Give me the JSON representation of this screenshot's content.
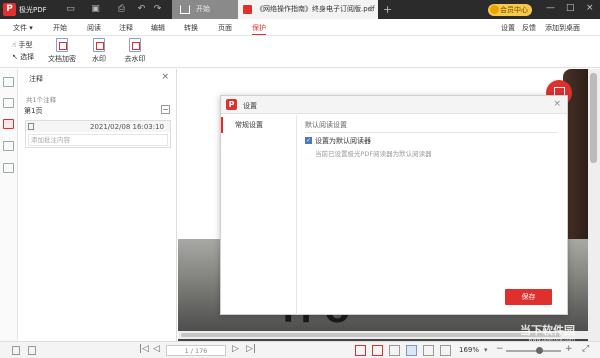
{
  "app": {
    "name": "极光PDF"
  },
  "tabs": [
    {
      "label": "开始"
    },
    {
      "label": "《网络操作指南》终身电子订阅版.pdf"
    }
  ],
  "vip": {
    "label": "会员中心"
  },
  "menu": {
    "file": "文件",
    "items": [
      "开始",
      "阅读",
      "注释",
      "编辑",
      "转换",
      "页面",
      "保护"
    ],
    "active": "保护",
    "right": [
      "设置",
      "反馈",
      "添加到桌面"
    ]
  },
  "toolbar": {
    "hand": "手型",
    "select": "选择",
    "tools": [
      {
        "label": "文档加密",
        "icon": "encrypt-icon"
      },
      {
        "label": "水印",
        "icon": "watermark-icon"
      },
      {
        "label": "去水印",
        "icon": "remove-watermark-icon"
      }
    ]
  },
  "panel": {
    "title": "注释",
    "count": "共1个注释",
    "page": "第1页",
    "note": {
      "time": "2021/02/08 16:03:10",
      "placeholder": "添加批注内容"
    }
  },
  "document": {
    "photo_text": "ТРО"
  },
  "dialog": {
    "title": "设置",
    "nav": [
      "常规设置"
    ],
    "section_title": "默认阅读设置",
    "checkbox_label": "设置为默认阅读器",
    "checkbox_checked": true,
    "hint": "当前已设置极光PDF阅读器为默认阅读器",
    "save": "保存"
  },
  "status": {
    "page_value": "1 / 176",
    "zoom": "169%"
  },
  "watermark": {
    "main": "当下软件园",
    "sub": "www.downxia.com"
  },
  "colors": {
    "accent": "#e0302e",
    "titlebar": "#2b2b2b",
    "vip": "#f6c94b"
  }
}
